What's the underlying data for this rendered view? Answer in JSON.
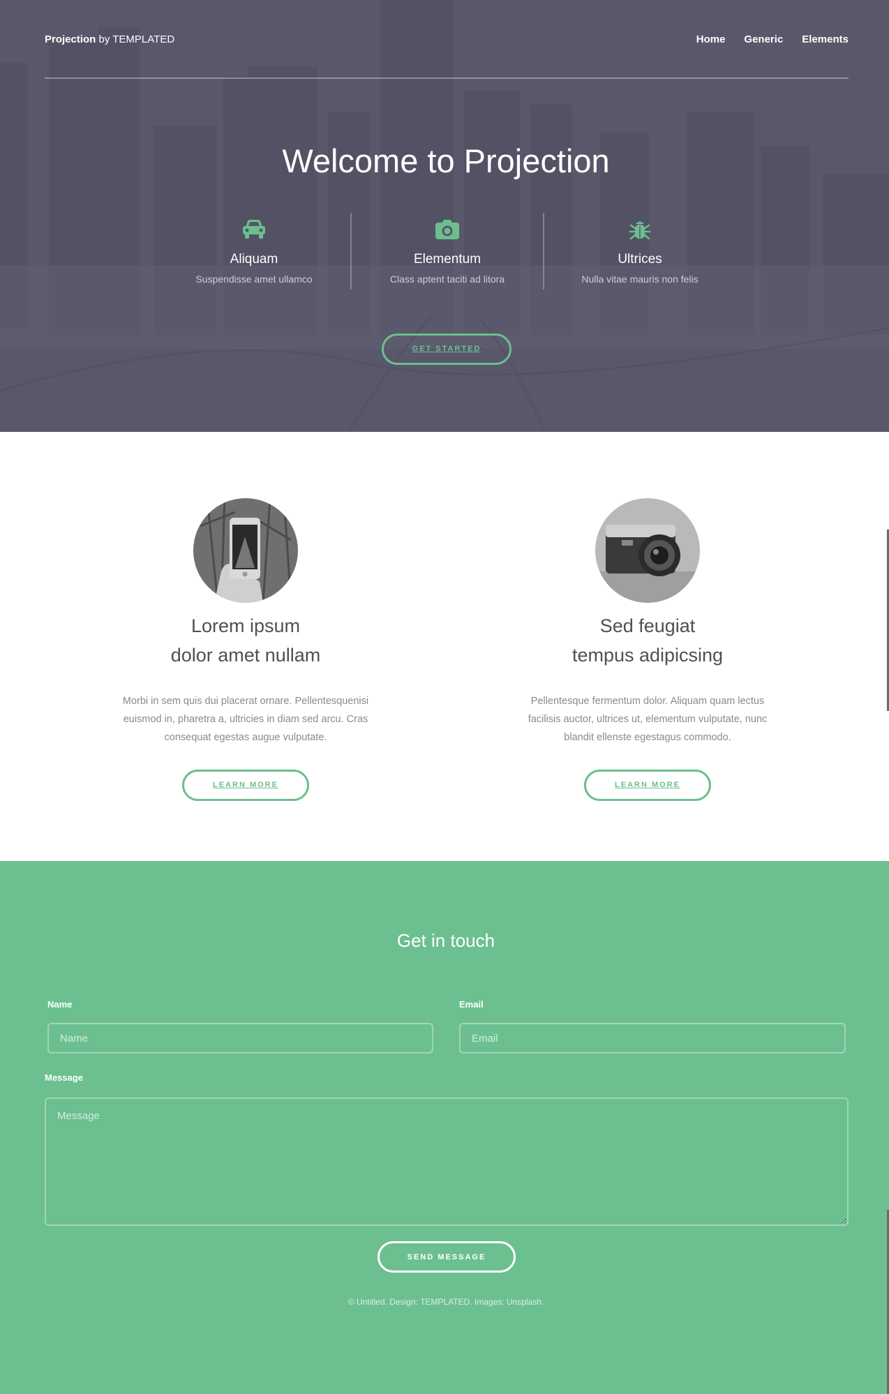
{
  "header": {
    "logo_bold": "Projection",
    "logo_rest": " by TEMPLATED",
    "nav": [
      "Home",
      "Generic",
      "Elements"
    ]
  },
  "hero": {
    "title": "Welcome to Projection",
    "features": [
      {
        "icon": "car-icon",
        "title": "Aliquam",
        "desc": "Suspendisse amet ullamco"
      },
      {
        "icon": "camera-icon",
        "title": "Elementum",
        "desc": "Class aptent taciti ad litora"
      },
      {
        "icon": "bug-icon",
        "title": "Ultrices",
        "desc": "Nulla vitae mauris non felis"
      }
    ],
    "cta": "Get Started"
  },
  "spotlights": [
    {
      "image": "phone-photo",
      "title_line1": "Lorem ipsum",
      "title_line2": "dolor amet nullam",
      "text": "Morbi in sem quis dui placerat ornare. Pellentesquenisi euismod in, pharetra a, ultricies in diam sed arcu. Cras consequat egestas augue vulputate.",
      "button": "Learn More"
    },
    {
      "image": "camera-photo",
      "title_line1": "Sed feugiat",
      "title_line2": "tempus adipicsing",
      "text": "Pellentesque fermentum dolor. Aliquam quam lectus facilisis auctor, ultrices ut, elementum vulputate, nunc blandit ellenste egestagus commodo.",
      "button": "Learn More"
    }
  ],
  "contact": {
    "heading": "Get in touch",
    "name_label": "Name",
    "name_placeholder": "Name",
    "email_label": "Email",
    "email_placeholder": "Email",
    "message_label": "Message",
    "message_placeholder": "Message",
    "submit": "Send Message"
  },
  "footer": {
    "copyright": "© Untitled. Design: TEMPLATED. Images: Unsplash."
  },
  "colors": {
    "accent": "#6bbf8e",
    "hero_overlay": "#585669",
    "contact_bg": "#6cc090"
  }
}
